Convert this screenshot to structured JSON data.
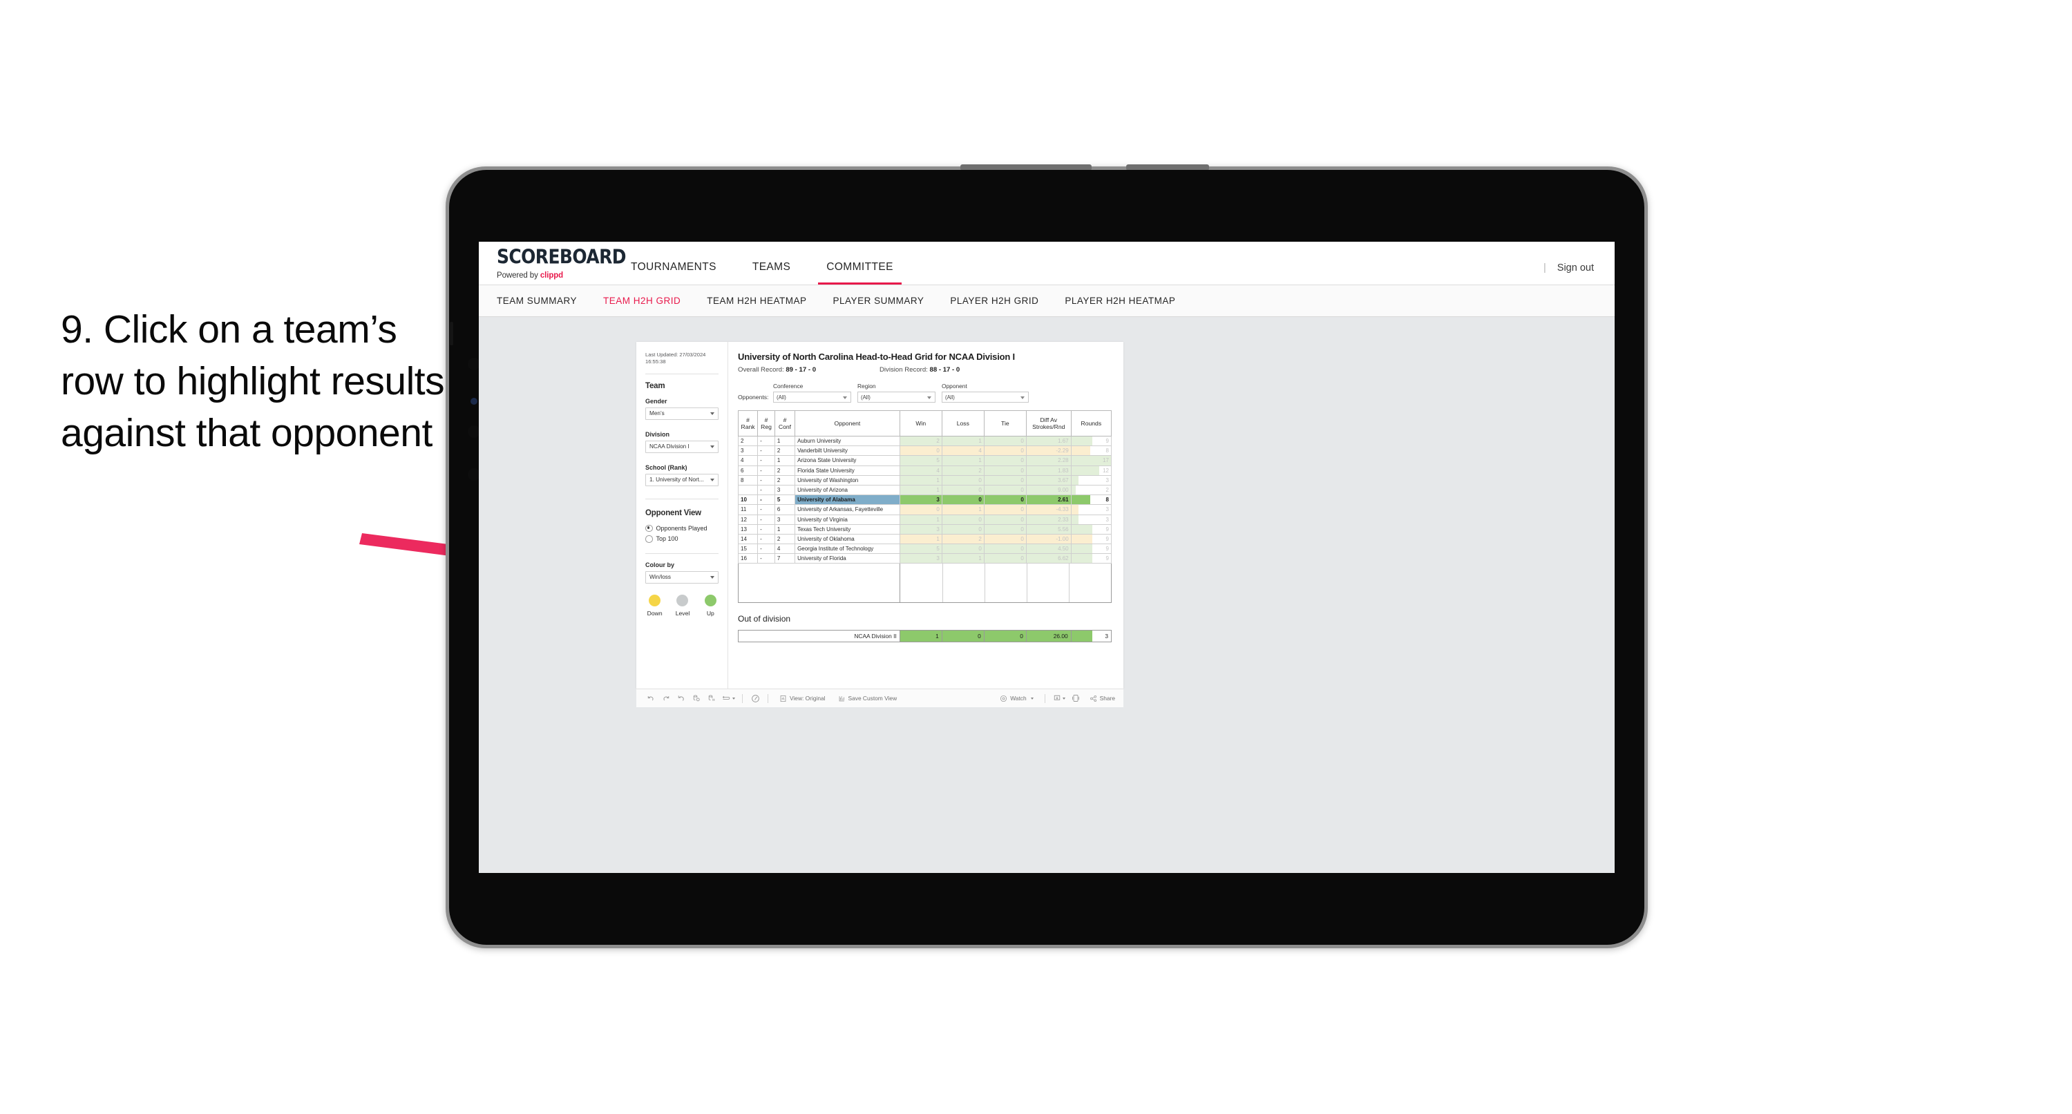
{
  "annotation": {
    "text": "9. Click on a team’s row to highlight results against that opponent"
  },
  "app": {
    "brand_title": "SCOREBOARD",
    "brand_sub_prefix": "Powered by ",
    "brand_sub_accent": "clippd",
    "accent_color": "#e8194b",
    "top_nav": [
      {
        "label": "TOURNAMENTS",
        "active": false
      },
      {
        "label": "TEAMS",
        "active": false
      },
      {
        "label": "COMMITTEE",
        "active": true
      }
    ],
    "signout_label": "Sign out",
    "sub_nav": [
      {
        "label": "TEAM SUMMARY",
        "active": false
      },
      {
        "label": "TEAM H2H GRID",
        "active": true
      },
      {
        "label": "TEAM H2H HEATMAP",
        "active": false
      },
      {
        "label": "PLAYER SUMMARY",
        "active": false
      },
      {
        "label": "PLAYER H2H GRID",
        "active": false
      },
      {
        "label": "PLAYER H2H HEATMAP",
        "active": false
      }
    ]
  },
  "pane": {
    "last_updated": "Last Updated: 27/03/2024 16:55:38",
    "team_heading": "Team",
    "gender_label": "Gender",
    "gender_value": "Men’s",
    "division_label": "Division",
    "division_value": "NCAA Division I",
    "school_label": "School (Rank)",
    "school_value": "1. University of Nort...",
    "opponent_view_heading": "Opponent View",
    "opponent_view_options": [
      {
        "label": "Opponents Played",
        "selected": true
      },
      {
        "label": "Top 100",
        "selected": false
      }
    ],
    "colour_by_label": "Colour by",
    "colour_by_value": "Win/loss",
    "legend": [
      {
        "label": "Down",
        "color": "#f5d547"
      },
      {
        "label": "Level",
        "color": "#c8cbcc"
      },
      {
        "label": "Up",
        "color": "#8dc96b"
      }
    ]
  },
  "main": {
    "title": "University of North Carolina Head-to-Head Grid for NCAA Division I",
    "overall_record_label": "Overall Record: ",
    "overall_record_value": "89 - 17 - 0",
    "division_record_label": "Division Record: ",
    "division_record_value": "88 - 17 - 0",
    "opponents_label": "Opponents:",
    "filters": [
      {
        "label": "Conference",
        "value": "(All)"
      },
      {
        "label": "Region",
        "value": "(All)"
      },
      {
        "label": "Opponent",
        "value": "(All)"
      }
    ],
    "out_of_division_heading": "Out of division"
  },
  "chart_data": {
    "type": "table",
    "title": "University of North Carolina Head-to-Head Grid for NCAA Division I",
    "columns": [
      "# Rank",
      "# Reg",
      "# Conf",
      "Opponent",
      "Win",
      "Loss",
      "Tie",
      "Diff Av Strokes/Rnd",
      "Rounds"
    ],
    "rounds_max": 17,
    "rows": [
      {
        "rank": "2",
        "reg": "-",
        "conf": "1",
        "opponent": "Auburn University",
        "win": "2",
        "loss": "1",
        "tie": "0",
        "diff": "1.67",
        "rounds": "9",
        "tone": "up",
        "highlighted": false
      },
      {
        "rank": "3",
        "reg": "-",
        "conf": "2",
        "opponent": "Vanderbilt University",
        "win": "0",
        "loss": "4",
        "tie": "0",
        "diff": "-2.29",
        "rounds": "8",
        "tone": "down",
        "highlighted": false
      },
      {
        "rank": "4",
        "reg": "-",
        "conf": "1",
        "opponent": "Arizona State University",
        "win": "5",
        "loss": "1",
        "tie": "0",
        "diff": "2.28",
        "rounds": "17",
        "tone": "up",
        "highlighted": false
      },
      {
        "rank": "6",
        "reg": "-",
        "conf": "2",
        "opponent": "Florida State University",
        "win": "4",
        "loss": "2",
        "tie": "0",
        "diff": "1.83",
        "rounds": "12",
        "tone": "up",
        "highlighted": false
      },
      {
        "rank": "8",
        "reg": "-",
        "conf": "2",
        "opponent": "University of Washington",
        "win": "1",
        "loss": "0",
        "tie": "0",
        "diff": "3.67",
        "rounds": "3",
        "tone": "up",
        "highlighted": false
      },
      {
        "rank": "",
        "reg": "-",
        "conf": "3",
        "opponent": "University of Arizona",
        "win": "1",
        "loss": "0",
        "tie": "0",
        "diff": "9.00",
        "rounds": "2",
        "tone": "up",
        "highlighted": false
      },
      {
        "rank": "10",
        "reg": "-",
        "conf": "5",
        "opponent": "University of Alabama",
        "win": "3",
        "loss": "0",
        "tie": "0",
        "diff": "2.61",
        "rounds": "8",
        "tone": "up",
        "highlighted": true
      },
      {
        "rank": "11",
        "reg": "-",
        "conf": "6",
        "opponent": "University of Arkansas, Fayetteville",
        "win": "0",
        "loss": "1",
        "tie": "0",
        "diff": "-4.33",
        "rounds": "3",
        "tone": "down",
        "highlighted": false
      },
      {
        "rank": "12",
        "reg": "-",
        "conf": "3",
        "opponent": "University of Virginia",
        "win": "1",
        "loss": "0",
        "tie": "0",
        "diff": "2.33",
        "rounds": "3",
        "tone": "up",
        "highlighted": false
      },
      {
        "rank": "13",
        "reg": "-",
        "conf": "1",
        "opponent": "Texas Tech University",
        "win": "3",
        "loss": "0",
        "tie": "0",
        "diff": "5.56",
        "rounds": "9",
        "tone": "up",
        "highlighted": false
      },
      {
        "rank": "14",
        "reg": "-",
        "conf": "2",
        "opponent": "University of Oklahoma",
        "win": "1",
        "loss": "2",
        "tie": "0",
        "diff": "-1.00",
        "rounds": "9",
        "tone": "down",
        "highlighted": false
      },
      {
        "rank": "15",
        "reg": "-",
        "conf": "4",
        "opponent": "Georgia Institute of Technology",
        "win": "5",
        "loss": "0",
        "tie": "0",
        "diff": "4.50",
        "rounds": "9",
        "tone": "up",
        "highlighted": false
      },
      {
        "rank": "16",
        "reg": "-",
        "conf": "7",
        "opponent": "University of Florida",
        "win": "3",
        "loss": "1",
        "tie": "0",
        "diff": "6.62",
        "rounds": "9",
        "tone": "up",
        "highlighted": false
      }
    ],
    "out_of_division": {
      "name": "NCAA Division II",
      "win": "1",
      "loss": "0",
      "tie": "0",
      "diff": "26.00",
      "rounds": "3"
    }
  },
  "toolbar": {
    "view_label": "View: Original",
    "save_label": "Save Custom View",
    "watch_label": "Watch",
    "share_label": "Share"
  }
}
